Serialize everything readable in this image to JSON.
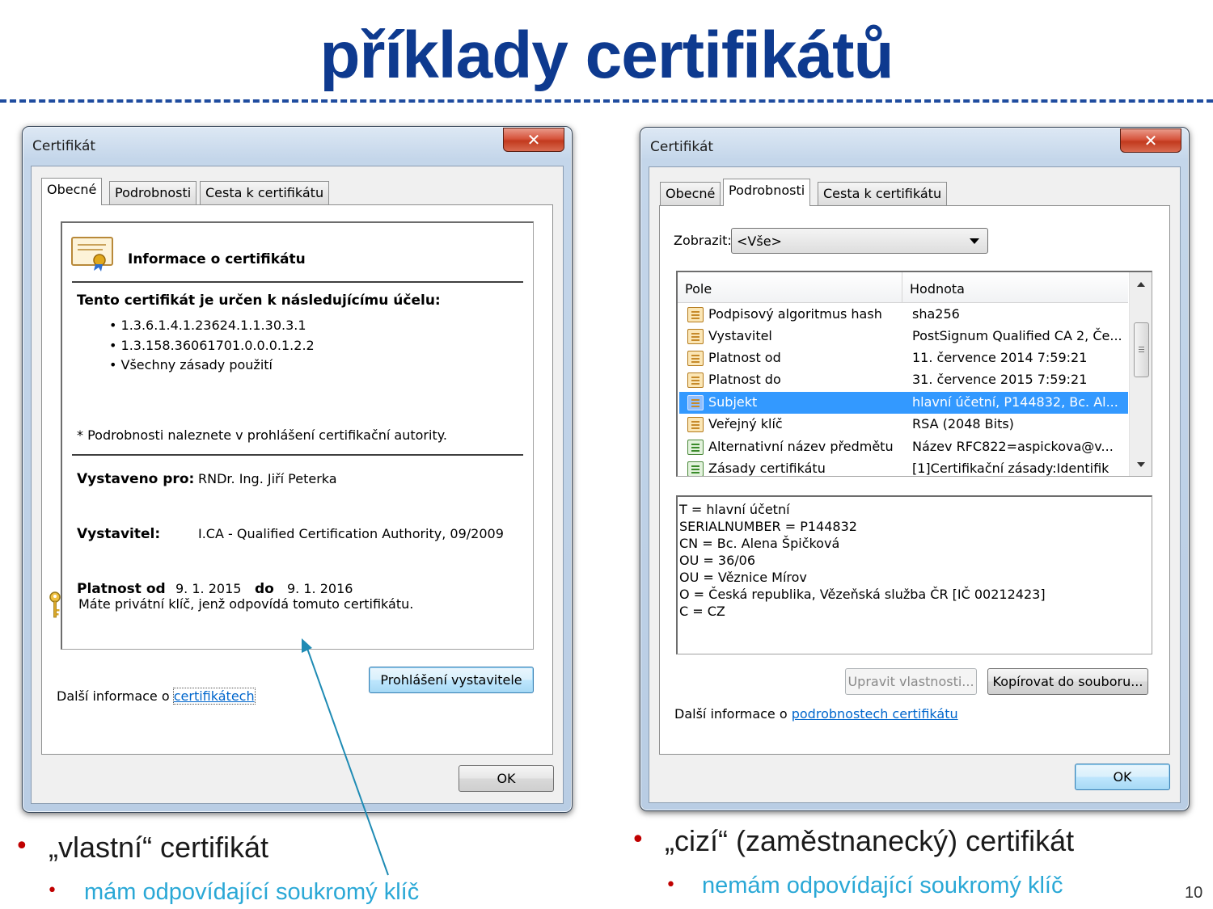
{
  "slide": {
    "title": "příklady certifikátů",
    "page_number": "10",
    "bullets_left": {
      "main": "„vlastní“ certifikát",
      "sub": "mám odpovídající soukromý klíč"
    },
    "bullets_right": {
      "main": "„cizí“ (zaměstnanecký) certifikát",
      "sub": "nemám odpovídající soukromý klíč"
    },
    "bullet_glyph": "•"
  },
  "dialog_left": {
    "title": "Certifikát",
    "close_glyph": "✕",
    "tabs": [
      "Obecné",
      "Podrobnosti",
      "Cesta k certifikátu"
    ],
    "info_heading": "Informace o certifikátu",
    "purpose_heading": "Tento certifikát je určen k následujícímu účelu:",
    "purposes": [
      "• 1.3.6.1.4.1.23624.1.1.30.3.1",
      "• 1.3.158.36061701.0.0.0.1.2.2",
      "• Všechny zásady použití"
    ],
    "footnote": "* Podrobnosti naleznete v prohlášení certifikační autority.",
    "issued_to_label": "Vystaveno pro:",
    "issued_to_value": "RNDr. Ing. Jiří Peterka",
    "issuer_label": "Vystavitel:",
    "issuer_value": "I.CA - Qualified Certification Authority, 09/2009",
    "valid_from_label": "Platnost od",
    "valid_from_value": "9. 1. 2015",
    "valid_to_label": "do",
    "valid_to_value": "9. 1. 2016",
    "private_key_note": "Máte privátní klíč, jenž odpovídá tomuto certifikátu.",
    "issuer_statement_button": "Prohlášení vystavitele",
    "more_info_prefix": "Další informace o ",
    "more_info_link": "certifikátech",
    "ok_button": "OK"
  },
  "dialog_right": {
    "title": "Certifikát",
    "close_glyph": "✕",
    "tabs": [
      "Obecné",
      "Podrobnosti",
      "Cesta k certifikátu"
    ],
    "show_label": "Zobrazit:",
    "show_value": "<Vše>",
    "columns": [
      "Pole",
      "Hodnota"
    ],
    "rows": [
      {
        "field": "Podpisový algoritmus hash",
        "value": "sha256"
      },
      {
        "field": "Vystavitel",
        "value": "PostSignum Qualified CA 2, Če..."
      },
      {
        "field": "Platnost od",
        "value": "11. července 2014 7:59:21"
      },
      {
        "field": "Platnost do",
        "value": "31. července 2015 7:59:21"
      },
      {
        "field": "Subjekt",
        "value": "hlavní účetní, P144832, Bc. Al..."
      },
      {
        "field": "Veřejný klíč",
        "value": "RSA (2048 Bits)"
      },
      {
        "field": "Alternativní název předmětu",
        "value": "Název RFC822=aspickova@v..."
      },
      {
        "field": "Zásady certifikátu",
        "value": "[1]Certifikační zásady:Identifik"
      }
    ],
    "selected_row": "Subjekt",
    "details_lines": [
      "T = hlavní účetní",
      "SERIALNUMBER = P144832",
      "CN = Bc. Alena Špičková",
      "OU = 36/06",
      "OU = Věznice Mírov",
      "O = Česká republika, Vězeňská služba ČR [IČ 00212423]",
      "C = CZ"
    ],
    "edit_properties_button": "Upravit vlastnosti...",
    "copy_to_file_button": "Kopírovat do souboru...",
    "more_info_prefix": "Další informace o ",
    "more_info_link": "podrobnostech certifikátu",
    "ok_button": "OK"
  },
  "colors": {
    "title_blue": "#0e3a8f",
    "bullet_red": "#c00000",
    "sub_bullet_cyan": "#2aa8d6",
    "selection": "#3399ff",
    "arrow": "#1f8bb4"
  }
}
